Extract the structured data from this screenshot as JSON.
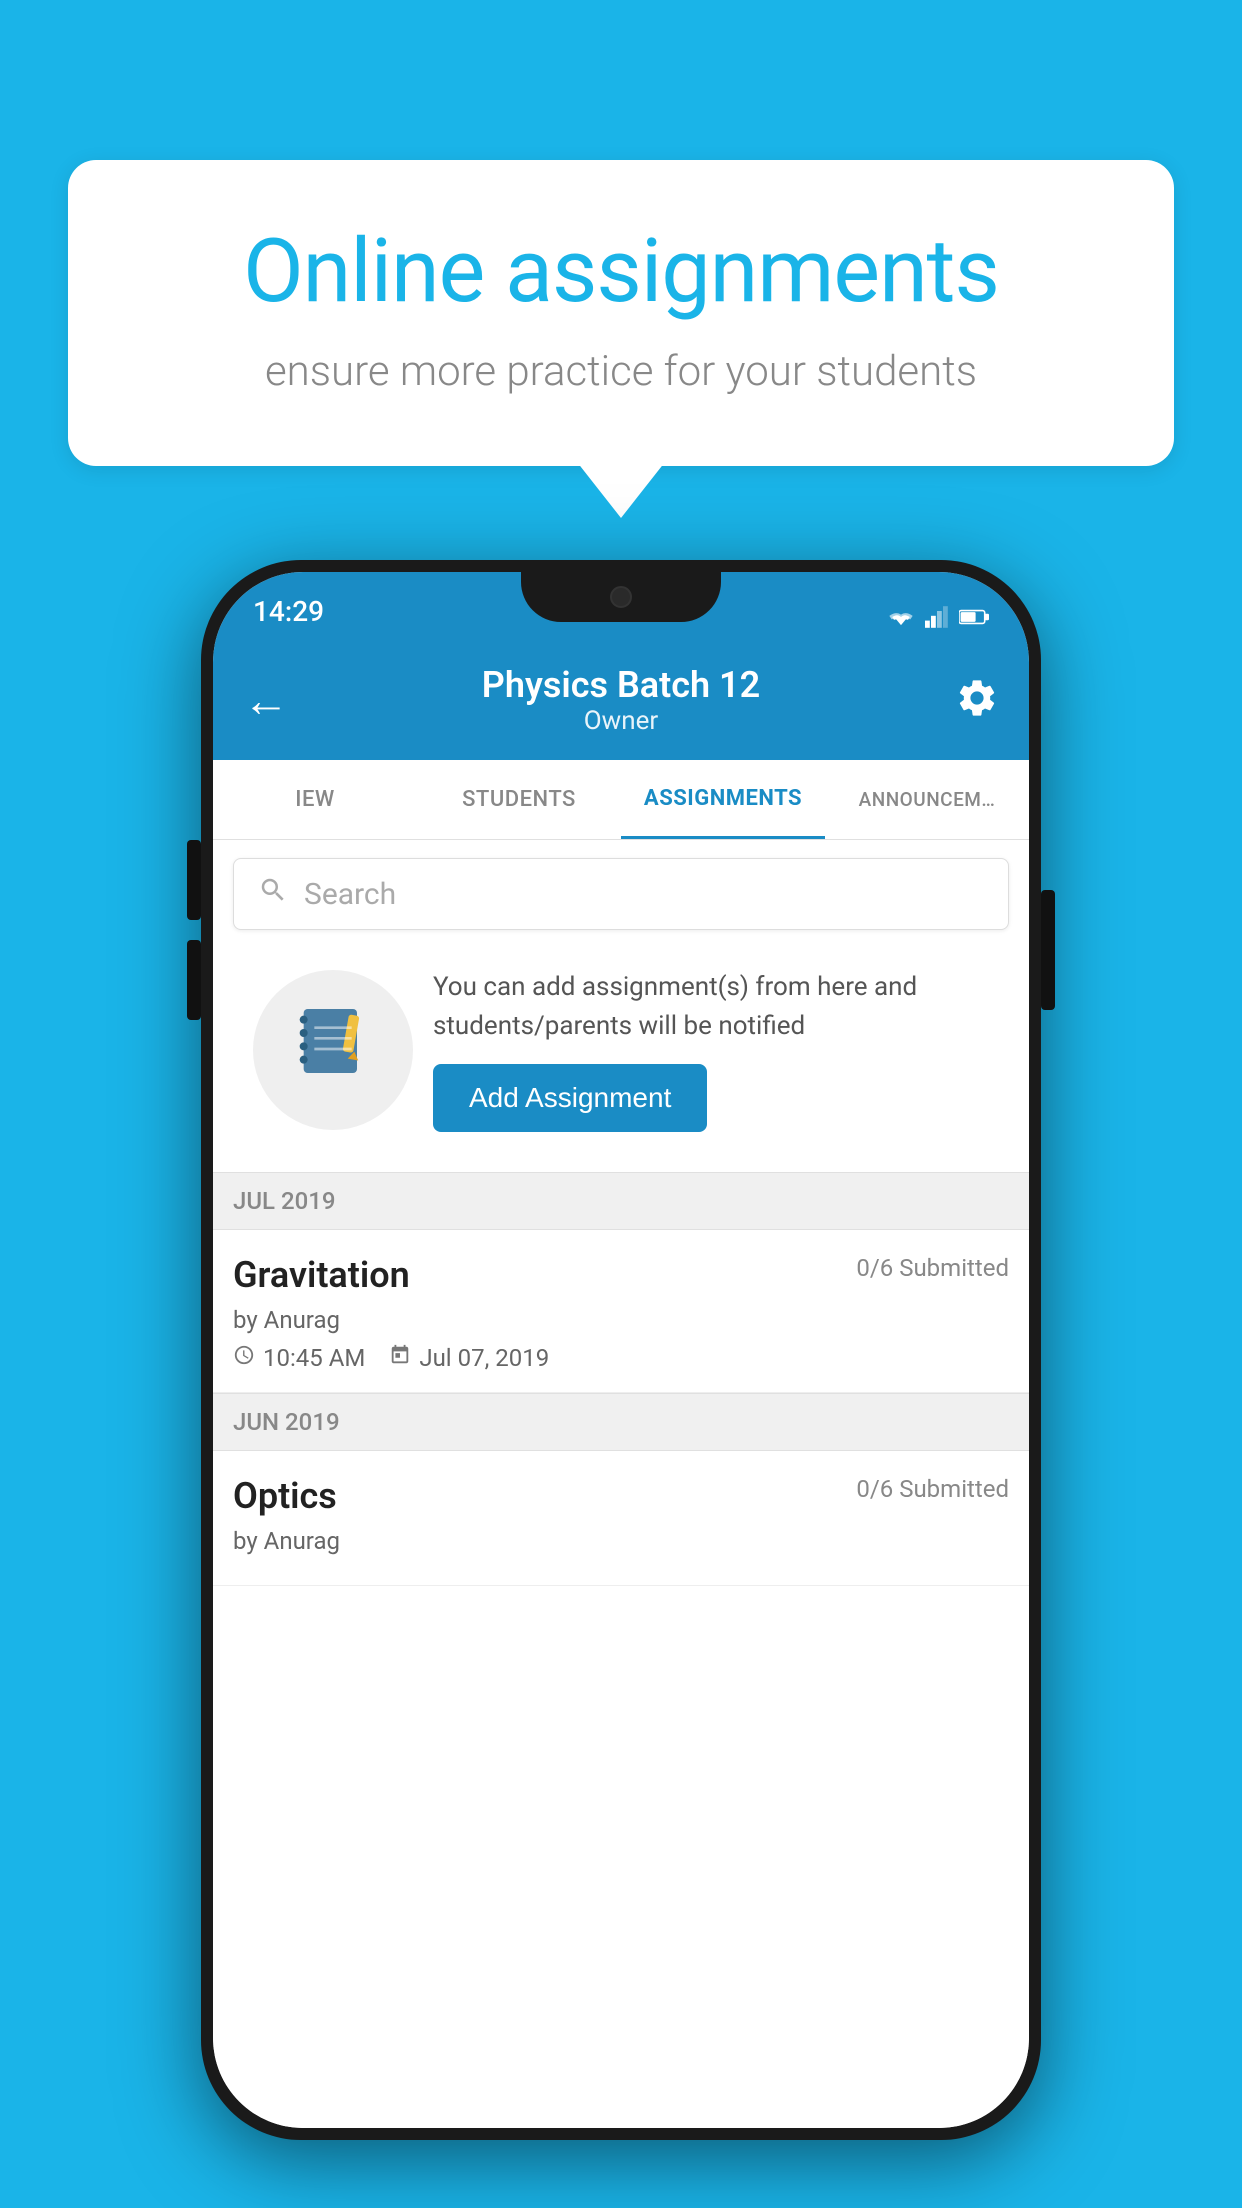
{
  "background": {
    "color": "#1ab4e8"
  },
  "speech_bubble": {
    "title": "Online assignments",
    "subtitle": "ensure more practice for your students"
  },
  "status_bar": {
    "time": "14:29"
  },
  "header": {
    "title": "Physics Batch 12",
    "subtitle": "Owner",
    "back_label": "←",
    "gear_label": "⚙"
  },
  "tabs": [
    {
      "label": "IEW",
      "active": false
    },
    {
      "label": "STUDENTS",
      "active": false
    },
    {
      "label": "ASSIGNMENTS",
      "active": true
    },
    {
      "label": "ANNOUNCEM…",
      "active": false
    }
  ],
  "search": {
    "placeholder": "Search"
  },
  "promo": {
    "description": "You can add assignment(s) from here and students/parents will be notified",
    "button_label": "Add Assignment"
  },
  "sections": [
    {
      "label": "JUL 2019",
      "assignments": [
        {
          "title": "Gravitation",
          "status": "0/6 Submitted",
          "by": "by Anurag",
          "time": "10:45 AM",
          "date": "Jul 07, 2019"
        }
      ]
    },
    {
      "label": "JUN 2019",
      "assignments": [
        {
          "title": "Optics",
          "status": "0/6 Submitted",
          "by": "by Anurag",
          "time": "",
          "date": ""
        }
      ]
    }
  ]
}
